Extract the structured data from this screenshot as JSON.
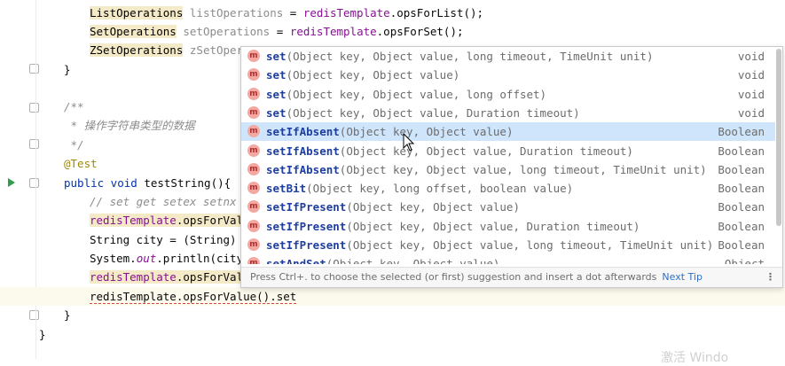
{
  "code": {
    "line1": {
      "type": "ListOperations",
      "var": "listOperations",
      "op": "=",
      "obj": "redisTemplate",
      "call": ".opsForList();"
    },
    "line2": {
      "type": "SetOperations",
      "var": "setOperations",
      "op": "=",
      "obj": "redisTemplate",
      "call": ".opsForSet();"
    },
    "line3": {
      "type": "ZSetOperations",
      "var": "zSetOpera"
    },
    "line4": "}",
    "line5": "/**",
    "line6": " * 操作字符串类型的数据",
    "line7": " */",
    "line8": "@Test",
    "line9": {
      "kw": "public void",
      "name": " testString(){"
    },
    "line10": "// set get setex setnx",
    "line11": {
      "obj": "redisTemplate",
      "call": ".opsForValu"
    },
    "line12": {
      "text": "String city = (String) r"
    },
    "line13": {
      "pre": "System.",
      "field": "out",
      "post": ".println(city)"
    },
    "line14": {
      "obj": "redisTemplate",
      "call": ".opsForValu"
    },
    "line15": "redisTemplate.opsForValue().set",
    "line16": "}",
    "line17": "}"
  },
  "completion": {
    "items": [
      {
        "name": "set",
        "params": "(Object key, Object value, long timeout, TimeUnit unit)",
        "ret": "void",
        "selected": false
      },
      {
        "name": "set",
        "params": "(Object key, Object value)",
        "ret": "void",
        "selected": false
      },
      {
        "name": "set",
        "params": "(Object key, Object value, long offset)",
        "ret": "void",
        "selected": false
      },
      {
        "name": "set",
        "params": "(Object key, Object value, Duration timeout)",
        "ret": "void",
        "selected": false
      },
      {
        "name": "setIfAbsent",
        "params": "(Object key, Object value)",
        "ret": "Boolean",
        "selected": true
      },
      {
        "name": "setIfAbsent",
        "params": "(Object key, Object value, Duration timeout)",
        "ret": "Boolean",
        "selected": false
      },
      {
        "name": "setIfAbsent",
        "params": "(Object key, Object value, long timeout, TimeUnit unit)",
        "ret": "Boolean",
        "selected": false
      },
      {
        "name": "setBit",
        "params": "(Object key, long offset, boolean value)",
        "ret": "Boolean",
        "selected": false
      },
      {
        "name": "setIfPresent",
        "params": "(Object key, Object value)",
        "ret": "Boolean",
        "selected": false
      },
      {
        "name": "setIfPresent",
        "params": "(Object key, Object value, Duration timeout)",
        "ret": "Boolean",
        "selected": false
      },
      {
        "name": "setIfPresent",
        "params": "(Object key, Object value, long timeout, TimeUnit unit)",
        "ret": "Boolean",
        "selected": false
      },
      {
        "name": "setAndSet",
        "params": "(Object key, Object value)",
        "ret": "Object",
        "selected": false
      }
    ],
    "badge": "m",
    "hint": "Press Ctrl+. to choose the selected (or first) suggestion and insert a dot afterwards",
    "next_tip": "Next Tip",
    "menu": "⋮"
  },
  "watermark": "激活 Windo"
}
